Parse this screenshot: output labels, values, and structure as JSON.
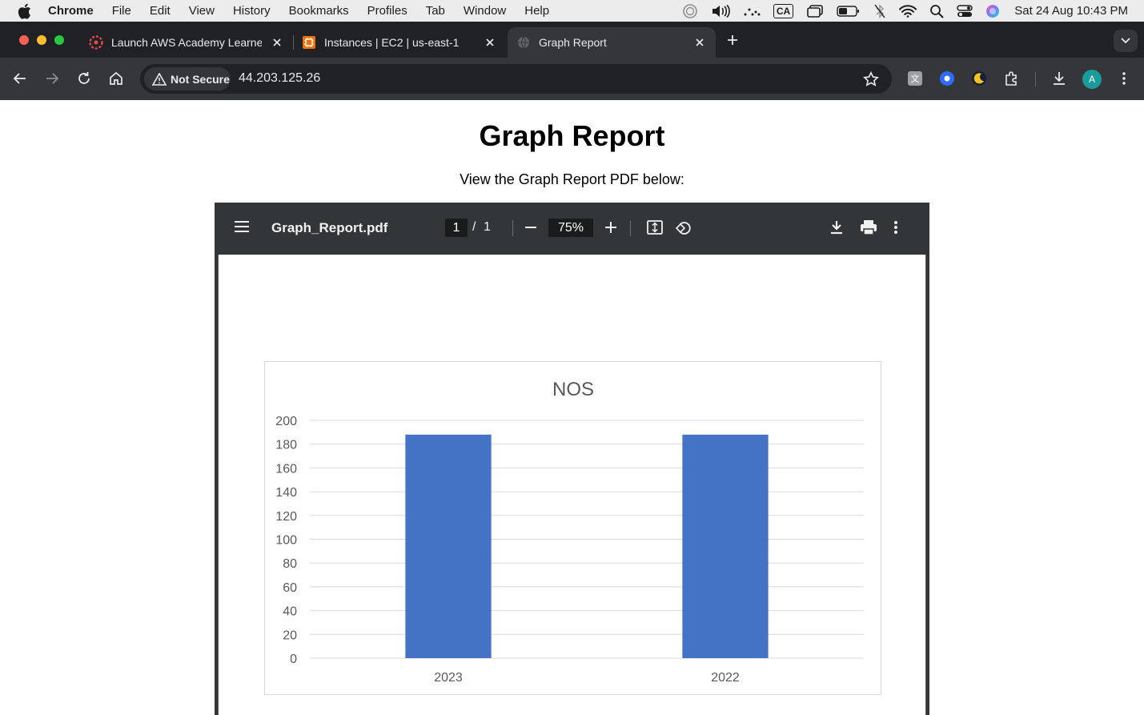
{
  "menubar": {
    "app": "Chrome",
    "items": [
      "File",
      "Edit",
      "View",
      "History",
      "Bookmarks",
      "Profiles",
      "Tab",
      "Window",
      "Help"
    ],
    "input_source": "CA",
    "clock": "Sat 24 Aug  10:43 PM"
  },
  "tabs": [
    {
      "title": "Launch AWS Academy Learne",
      "favicon": "aws-academy-icon"
    },
    {
      "title": "Instances | EC2 | us-east-1",
      "favicon": "aws-ec2-icon"
    },
    {
      "title": "Graph Report",
      "favicon": "globe-icon"
    }
  ],
  "toolbar": {
    "security_label": "Not Secure",
    "url": "44.203.125.26",
    "avatar_letter": "A"
  },
  "page": {
    "title": "Graph Report",
    "subtitle": "View the Graph Report PDF below:"
  },
  "pdf": {
    "filename": "Graph_Report.pdf",
    "page_current": "1",
    "page_sep": "/",
    "page_total": "1",
    "zoom": "75%"
  },
  "colors": {
    "bar": "#4472c4",
    "chrome_dark": "#202124",
    "chrome_toolbar": "#35363a",
    "pdf_toolbar": "#323639"
  },
  "chart_data": {
    "type": "bar",
    "title": "NOS",
    "categories": [
      "2023",
      "2022"
    ],
    "values": [
      188,
      188
    ],
    "ylim": [
      0,
      200
    ],
    "yticks": [
      0,
      20,
      40,
      60,
      80,
      100,
      120,
      140,
      160,
      180,
      200
    ],
    "grid": true,
    "legend": "none"
  }
}
